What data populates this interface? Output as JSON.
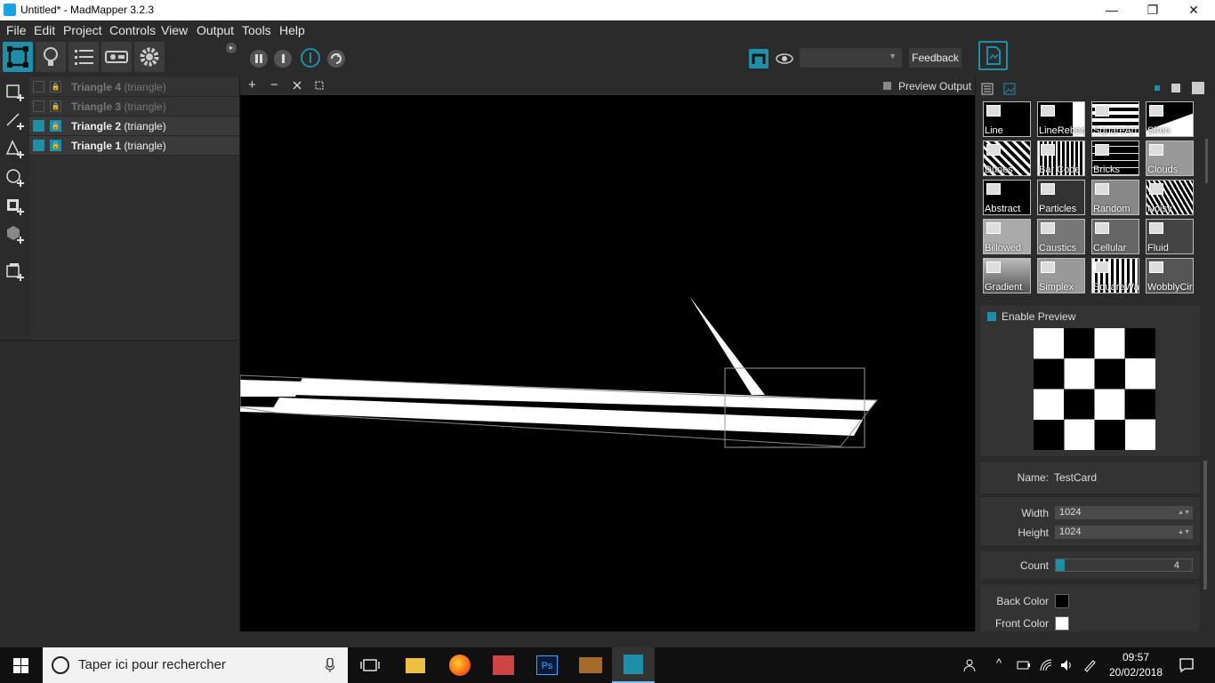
{
  "window": {
    "title": "Untitled* - MadMapper 3.2.3"
  },
  "menu": [
    "File",
    "Edit",
    "Project",
    "Controls",
    "View",
    "Output",
    "Tools",
    "Help"
  ],
  "toolbar": {
    "feedback_label": "Feedback",
    "dropdown_value": ""
  },
  "canvas_toolbar": {
    "zoom_in": "+",
    "zoom_out": "−",
    "preview_output_label": "Preview Output"
  },
  "layers": [
    {
      "name": "Triangle 4",
      "type": "(triangle)",
      "enabled": false
    },
    {
      "name": "Triangle 3",
      "type": "(triangle)",
      "enabled": false
    },
    {
      "name": "Triangle 2",
      "type": "(triangle)",
      "enabled": true
    },
    {
      "name": "Triangle 1",
      "type": "(triangle)",
      "enabled": true
    }
  ],
  "library": {
    "thumbnails": [
      "Line",
      "LineRebea",
      "SquareArr",
      "Siren",
      "Dunes",
      "Bar Code",
      "Bricks",
      "Clouds",
      "Abstract",
      "Particles",
      "Random",
      "Noisy",
      "Billowed",
      "Caustics",
      "Cellular",
      "Fluid",
      "Gradient",
      "Simplex",
      "SquareWa",
      "WobblyCir"
    ]
  },
  "preview": {
    "enable_label": "Enable Preview"
  },
  "properties": {
    "name_label": "Name:",
    "name_value": "TestCard",
    "width_label": "Width",
    "width_value": "1024",
    "height_label": "Height",
    "height_value": "1024",
    "count_label": "Count",
    "count_value": "4",
    "back_color_label": "Back Color",
    "back_color": "#000000",
    "front_color_label": "Front Color",
    "front_color": "#ffffff"
  },
  "taskbar": {
    "search_placeholder": "Taper ici pour rechercher",
    "time": "09:57",
    "date": "20/02/2018"
  },
  "colors": {
    "accent": "#1e8fa8"
  }
}
